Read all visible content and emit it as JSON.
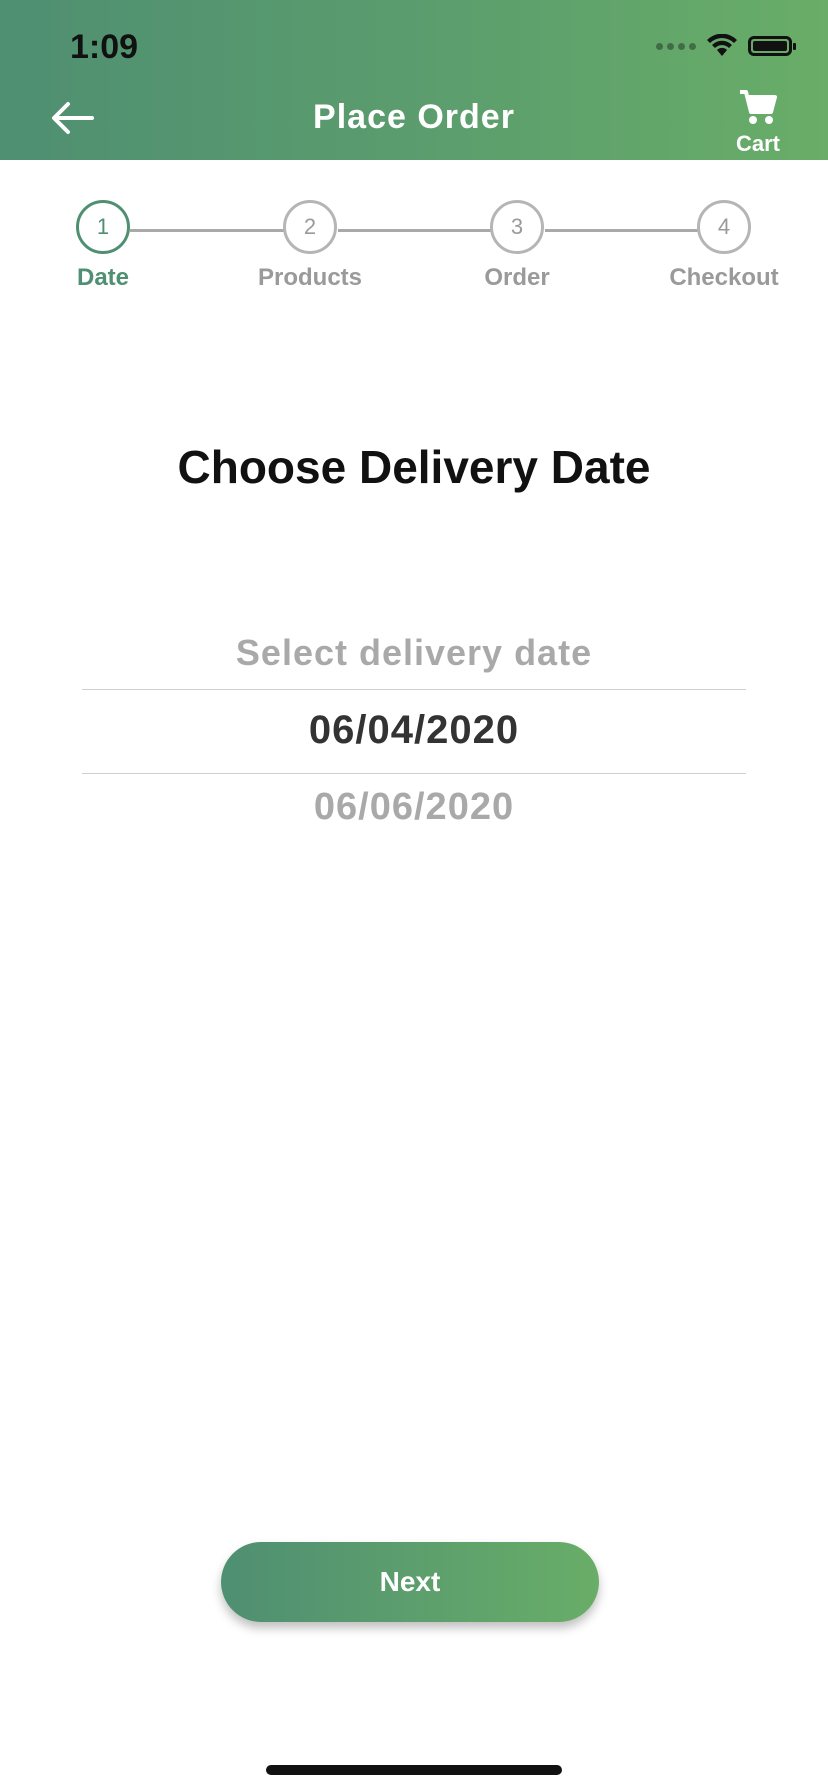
{
  "status_bar": {
    "time": "1:09"
  },
  "header": {
    "title": "Place Order",
    "cart_label": "Cart"
  },
  "steps": [
    {
      "number": "1",
      "label": "Date",
      "active": true
    },
    {
      "number": "2",
      "label": "Products",
      "active": false
    },
    {
      "number": "3",
      "label": "Order",
      "active": false
    },
    {
      "number": "4",
      "label": "Checkout",
      "active": false
    }
  ],
  "main": {
    "heading": "Choose Delivery Date",
    "picker": {
      "placeholder": "Select delivery date",
      "selected": "06/04/2020",
      "next_option": "06/06/2020"
    },
    "next_button": "Next"
  },
  "colors": {
    "brand_green": "#4f8f72",
    "brand_green_light": "#69ad68",
    "inactive_gray": "#9a9a9a"
  }
}
